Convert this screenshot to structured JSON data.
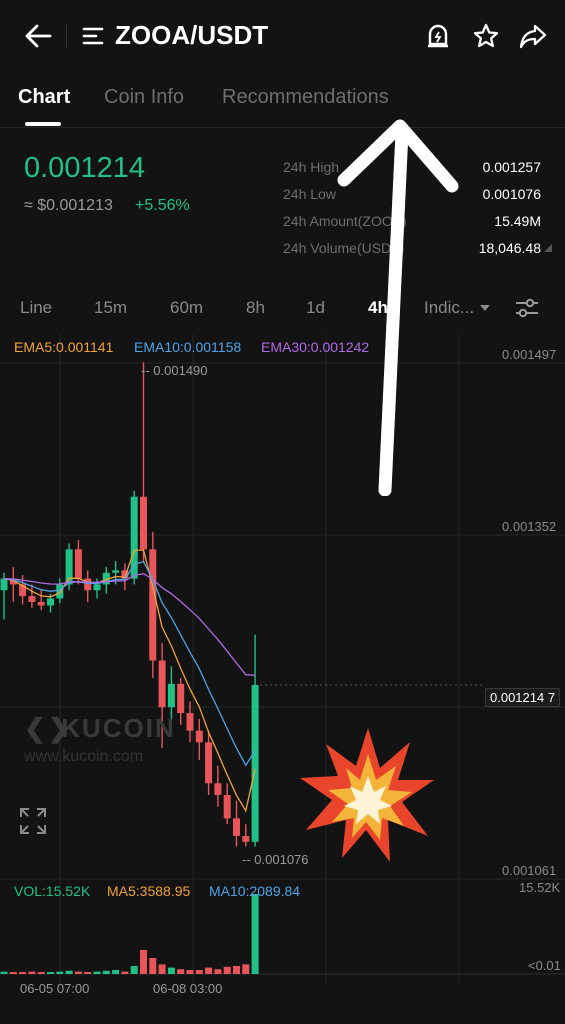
{
  "header": {
    "pair": "ZOOA/USDT",
    "icons": [
      "back-arrow-icon",
      "menu-icon",
      "price-alert-icon",
      "star-icon",
      "share-icon"
    ]
  },
  "tabs": [
    {
      "label": "Chart",
      "active": true
    },
    {
      "label": "Coin Info",
      "active": false
    },
    {
      "label": "Recommendations",
      "active": false
    }
  ],
  "ticker": {
    "last_price": "0.001214",
    "usd_price": "≈ $0.001213",
    "change": "+5.56%",
    "stats": [
      {
        "label": "24h High",
        "value": "0.001257"
      },
      {
        "label": "24h Low",
        "value": "0.001076"
      },
      {
        "label": "24h Amount(ZOOA)",
        "value": "15.49M"
      },
      {
        "label": "24h Volume(USDT)",
        "value": "18,046.48"
      }
    ]
  },
  "intervals": [
    {
      "label": "Line",
      "active": false
    },
    {
      "label": "15m",
      "active": false
    },
    {
      "label": "60m",
      "active": false
    },
    {
      "label": "8h",
      "active": false
    },
    {
      "label": "1d",
      "active": false
    },
    {
      "label": "4h",
      "active": true
    },
    {
      "label": "Indic...",
      "active": false
    }
  ],
  "indicators": {
    "ema5": "EMA5:0.001141",
    "ema10": "EMA10:0.001158",
    "ema30": "EMA30:0.001242",
    "vol": "VOL:15.52K",
    "ma5": "MA5:3588.95",
    "ma10": "MA10:2089.84"
  },
  "axis": {
    "price_ticks": [
      "0.001497",
      "0.001352",
      "0.001061"
    ],
    "current_price": "0.001214",
    "current_price_suffix": "7",
    "high_marker": "0.001490",
    "low_marker": "0.001076",
    "vol_ticks": [
      "15.52K",
      "<0.01"
    ],
    "dates": [
      "06-05 07:00",
      "06-08 03:00"
    ]
  },
  "watermark": {
    "logo": "KUCOIN",
    "url": "www.kucoin.com"
  },
  "colors": {
    "up": "#21c087",
    "down": "#e8565c",
    "ema5": "#f2a33a",
    "ema10": "#4fa3e8",
    "ema30": "#b06ae6",
    "background": "#131313"
  },
  "chart_data": {
    "type": "candlestick",
    "interval": "4h",
    "ylim": [
      0.001061,
      0.001497
    ],
    "candles": [
      {
        "o": 0.001295,
        "h": 0.00131,
        "l": 0.00127,
        "c": 0.001305
      },
      {
        "o": 0.001305,
        "h": 0.001315,
        "l": 0.001285,
        "c": 0.0013
      },
      {
        "o": 0.0013,
        "h": 0.001308,
        "l": 0.001283,
        "c": 0.00129
      },
      {
        "o": 0.00129,
        "h": 0.0013,
        "l": 0.00128,
        "c": 0.001285
      },
      {
        "o": 0.001285,
        "h": 0.001295,
        "l": 0.001278,
        "c": 0.001282
      },
      {
        "o": 0.001282,
        "h": 0.001292,
        "l": 0.001276,
        "c": 0.001288
      },
      {
        "o": 0.001288,
        "h": 0.001305,
        "l": 0.001284,
        "c": 0.0013
      },
      {
        "o": 0.0013,
        "h": 0.001335,
        "l": 0.001295,
        "c": 0.00133
      },
      {
        "o": 0.00133,
        "h": 0.001338,
        "l": 0.0013,
        "c": 0.001305
      },
      {
        "o": 0.001305,
        "h": 0.001312,
        "l": 0.001285,
        "c": 0.001295
      },
      {
        "o": 0.001295,
        "h": 0.001305,
        "l": 0.001288,
        "c": 0.0013
      },
      {
        "o": 0.0013,
        "h": 0.001315,
        "l": 0.001292,
        "c": 0.00131
      },
      {
        "o": 0.00131,
        "h": 0.00132,
        "l": 0.0013,
        "c": 0.001312
      },
      {
        "o": 0.001312,
        "h": 0.001318,
        "l": 0.001295,
        "c": 0.001305
      },
      {
        "o": 0.001305,
        "h": 0.00138,
        "l": 0.0013,
        "c": 0.001375
      },
      {
        "o": 0.001375,
        "h": 0.00149,
        "l": 0.00132,
        "c": 0.00133
      },
      {
        "o": 0.00133,
        "h": 0.001345,
        "l": 0.00122,
        "c": 0.001235
      },
      {
        "o": 0.001235,
        "h": 0.00125,
        "l": 0.00116,
        "c": 0.001195
      },
      {
        "o": 0.001195,
        "h": 0.00123,
        "l": 0.001185,
        "c": 0.001215
      },
      {
        "o": 0.001215,
        "h": 0.00122,
        "l": 0.00118,
        "c": 0.00119
      },
      {
        "o": 0.00119,
        "h": 0.0012,
        "l": 0.001165,
        "c": 0.001175
      },
      {
        "o": 0.001175,
        "h": 0.001185,
        "l": 0.00115,
        "c": 0.001165
      },
      {
        "o": 0.001165,
        "h": 0.001175,
        "l": 0.00112,
        "c": 0.00113
      },
      {
        "o": 0.00113,
        "h": 0.001145,
        "l": 0.00111,
        "c": 0.00112
      },
      {
        "o": 0.00112,
        "h": 0.00113,
        "l": 0.001095,
        "c": 0.0011
      },
      {
        "o": 0.0011,
        "h": 0.001115,
        "l": 0.001076,
        "c": 0.001085
      },
      {
        "o": 0.001085,
        "h": 0.001095,
        "l": 0.001076,
        "c": 0.00108
      },
      {
        "o": 0.00108,
        "h": 0.001257,
        "l": 0.001076,
        "c": 0.001214
      }
    ],
    "volume": [
      0.03,
      0.02,
      0.02,
      0.03,
      0.02,
      0.02,
      0.03,
      0.04,
      0.03,
      0.02,
      0.03,
      0.04,
      0.05,
      0.03,
      0.1,
      0.3,
      0.2,
      0.12,
      0.08,
      0.06,
      0.05,
      0.05,
      0.08,
      0.06,
      0.09,
      0.1,
      0.12,
      1.0
    ]
  }
}
